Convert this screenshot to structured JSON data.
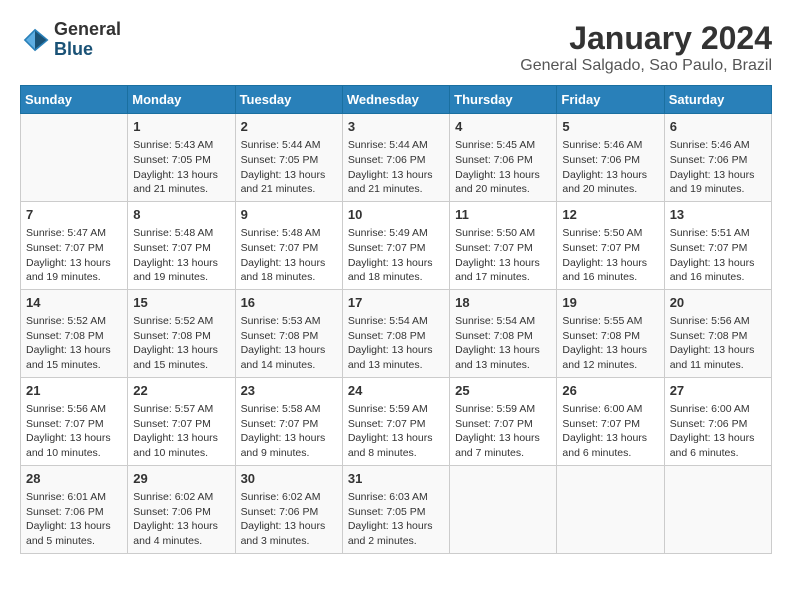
{
  "header": {
    "logo": {
      "general": "General",
      "blue": "Blue"
    },
    "title": "January 2024",
    "location": "General Salgado, Sao Paulo, Brazil"
  },
  "weekdays": [
    "Sunday",
    "Monday",
    "Tuesday",
    "Wednesday",
    "Thursday",
    "Friday",
    "Saturday"
  ],
  "weeks": [
    [
      {
        "day": "",
        "info": ""
      },
      {
        "day": "1",
        "info": "Sunrise: 5:43 AM\nSunset: 7:05 PM\nDaylight: 13 hours\nand 21 minutes."
      },
      {
        "day": "2",
        "info": "Sunrise: 5:44 AM\nSunset: 7:05 PM\nDaylight: 13 hours\nand 21 minutes."
      },
      {
        "day": "3",
        "info": "Sunrise: 5:44 AM\nSunset: 7:06 PM\nDaylight: 13 hours\nand 21 minutes."
      },
      {
        "day": "4",
        "info": "Sunrise: 5:45 AM\nSunset: 7:06 PM\nDaylight: 13 hours\nand 20 minutes."
      },
      {
        "day": "5",
        "info": "Sunrise: 5:46 AM\nSunset: 7:06 PM\nDaylight: 13 hours\nand 20 minutes."
      },
      {
        "day": "6",
        "info": "Sunrise: 5:46 AM\nSunset: 7:06 PM\nDaylight: 13 hours\nand 19 minutes."
      }
    ],
    [
      {
        "day": "7",
        "info": "Sunrise: 5:47 AM\nSunset: 7:07 PM\nDaylight: 13 hours\nand 19 minutes."
      },
      {
        "day": "8",
        "info": "Sunrise: 5:48 AM\nSunset: 7:07 PM\nDaylight: 13 hours\nand 19 minutes."
      },
      {
        "day": "9",
        "info": "Sunrise: 5:48 AM\nSunset: 7:07 PM\nDaylight: 13 hours\nand 18 minutes."
      },
      {
        "day": "10",
        "info": "Sunrise: 5:49 AM\nSunset: 7:07 PM\nDaylight: 13 hours\nand 18 minutes."
      },
      {
        "day": "11",
        "info": "Sunrise: 5:50 AM\nSunset: 7:07 PM\nDaylight: 13 hours\nand 17 minutes."
      },
      {
        "day": "12",
        "info": "Sunrise: 5:50 AM\nSunset: 7:07 PM\nDaylight: 13 hours\nand 16 minutes."
      },
      {
        "day": "13",
        "info": "Sunrise: 5:51 AM\nSunset: 7:07 PM\nDaylight: 13 hours\nand 16 minutes."
      }
    ],
    [
      {
        "day": "14",
        "info": "Sunrise: 5:52 AM\nSunset: 7:08 PM\nDaylight: 13 hours\nand 15 minutes."
      },
      {
        "day": "15",
        "info": "Sunrise: 5:52 AM\nSunset: 7:08 PM\nDaylight: 13 hours\nand 15 minutes."
      },
      {
        "day": "16",
        "info": "Sunrise: 5:53 AM\nSunset: 7:08 PM\nDaylight: 13 hours\nand 14 minutes."
      },
      {
        "day": "17",
        "info": "Sunrise: 5:54 AM\nSunset: 7:08 PM\nDaylight: 13 hours\nand 13 minutes."
      },
      {
        "day": "18",
        "info": "Sunrise: 5:54 AM\nSunset: 7:08 PM\nDaylight: 13 hours\nand 13 minutes."
      },
      {
        "day": "19",
        "info": "Sunrise: 5:55 AM\nSunset: 7:08 PM\nDaylight: 13 hours\nand 12 minutes."
      },
      {
        "day": "20",
        "info": "Sunrise: 5:56 AM\nSunset: 7:08 PM\nDaylight: 13 hours\nand 11 minutes."
      }
    ],
    [
      {
        "day": "21",
        "info": "Sunrise: 5:56 AM\nSunset: 7:07 PM\nDaylight: 13 hours\nand 10 minutes."
      },
      {
        "day": "22",
        "info": "Sunrise: 5:57 AM\nSunset: 7:07 PM\nDaylight: 13 hours\nand 10 minutes."
      },
      {
        "day": "23",
        "info": "Sunrise: 5:58 AM\nSunset: 7:07 PM\nDaylight: 13 hours\nand 9 minutes."
      },
      {
        "day": "24",
        "info": "Sunrise: 5:59 AM\nSunset: 7:07 PM\nDaylight: 13 hours\nand 8 minutes."
      },
      {
        "day": "25",
        "info": "Sunrise: 5:59 AM\nSunset: 7:07 PM\nDaylight: 13 hours\nand 7 minutes."
      },
      {
        "day": "26",
        "info": "Sunrise: 6:00 AM\nSunset: 7:07 PM\nDaylight: 13 hours\nand 6 minutes."
      },
      {
        "day": "27",
        "info": "Sunrise: 6:00 AM\nSunset: 7:06 PM\nDaylight: 13 hours\nand 6 minutes."
      }
    ],
    [
      {
        "day": "28",
        "info": "Sunrise: 6:01 AM\nSunset: 7:06 PM\nDaylight: 13 hours\nand 5 minutes."
      },
      {
        "day": "29",
        "info": "Sunrise: 6:02 AM\nSunset: 7:06 PM\nDaylight: 13 hours\nand 4 minutes."
      },
      {
        "day": "30",
        "info": "Sunrise: 6:02 AM\nSunset: 7:06 PM\nDaylight: 13 hours\nand 3 minutes."
      },
      {
        "day": "31",
        "info": "Sunrise: 6:03 AM\nSunset: 7:05 PM\nDaylight: 13 hours\nand 2 minutes."
      },
      {
        "day": "",
        "info": ""
      },
      {
        "day": "",
        "info": ""
      },
      {
        "day": "",
        "info": ""
      }
    ]
  ]
}
